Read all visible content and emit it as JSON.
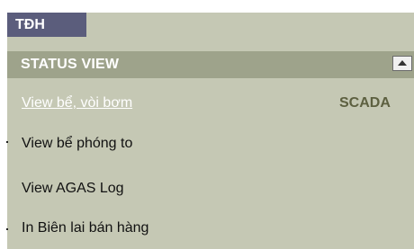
{
  "tab": {
    "label": "TĐH"
  },
  "section": {
    "title": "STATUS VIEW",
    "collapse_icon": "collapse-up-icon"
  },
  "menu": [
    {
      "label": "View bể, vòi bơm"
    },
    {
      "label": "View bể phóng to"
    },
    {
      "label": "View AGAS Log"
    },
    {
      "label": "In Biên lai bán hàng"
    }
  ],
  "side_label": "SCADA",
  "colors": {
    "panel": "#c5c8b4",
    "header": "#9ea38b",
    "tab": "#5b5d7c"
  }
}
